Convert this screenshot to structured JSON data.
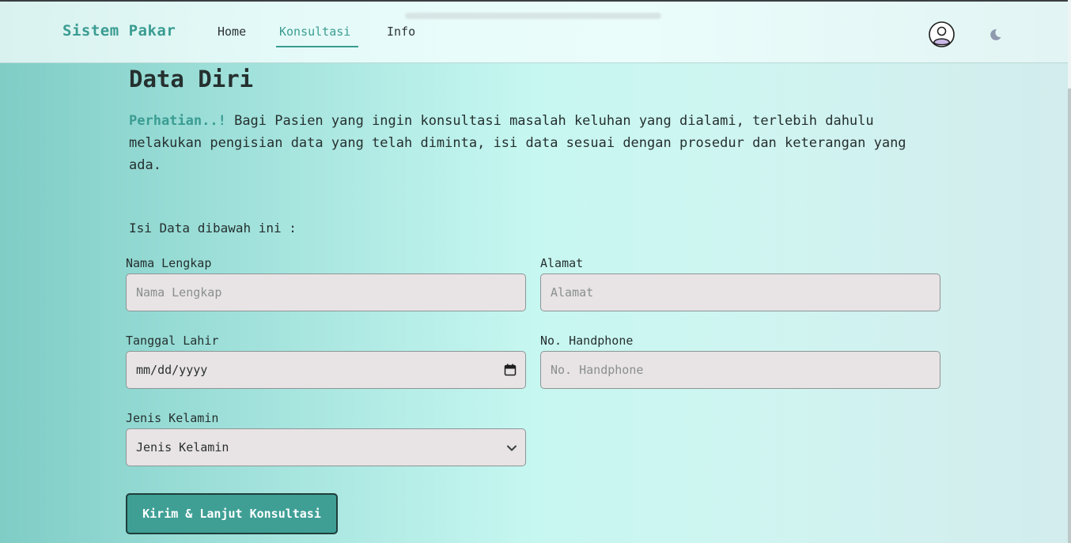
{
  "nav": {
    "brand": "Sistem Pakar",
    "items": [
      {
        "label": "Home"
      },
      {
        "label": "Konsultasi",
        "active": true
      },
      {
        "label": "Info"
      }
    ],
    "icons": {
      "profile": "user-circle-icon",
      "theme": "moon-icon"
    }
  },
  "main": {
    "title": "Data Diri",
    "warning": "Perhatian..!",
    "intro": "Bagi Pasien yang ingin konsultasi masalah keluhan yang dialami, terlebih dahulu melakukan pengisian data yang telah diminta, isi data sesuai dengan prosedur dan keterangan yang ada.",
    "instruction": "Isi Data dibawah ini :"
  },
  "form": {
    "nama": {
      "label": "Nama Lengkap",
      "placeholder": "Nama Lengkap"
    },
    "alamat": {
      "label": "Alamat",
      "placeholder": "Alamat"
    },
    "tanggal": {
      "label": "Tanggal Lahir",
      "value": "mm/dd/yyyy"
    },
    "hp": {
      "label": "No. Handphone",
      "placeholder": "No. Handphone"
    },
    "gender": {
      "label": "Jenis Kelamin",
      "selected": "Jenis Kelamin"
    },
    "submit_label": "Kirim & Lanjut Konsultasi"
  },
  "colors": {
    "accent": "#3a9c92",
    "button": "#3f9f95",
    "field_bg": "#e8e3e4"
  }
}
